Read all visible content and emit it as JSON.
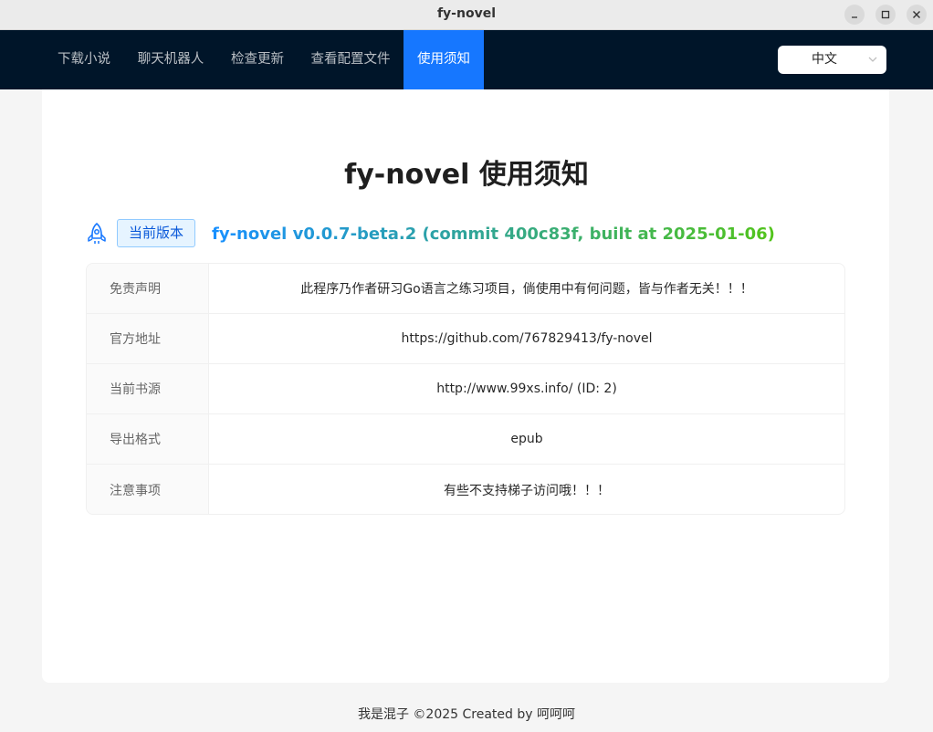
{
  "window": {
    "title": "fy-novel",
    "controls": [
      "minimize-icon",
      "maximize-icon",
      "close-icon"
    ]
  },
  "nav": {
    "items": [
      {
        "label": "下载小说",
        "active": false
      },
      {
        "label": "聊天机器人",
        "active": false
      },
      {
        "label": "检查更新",
        "active": false
      },
      {
        "label": "查看配置文件",
        "active": false
      },
      {
        "label": "使用须知",
        "active": true
      }
    ],
    "language": {
      "selected": "中文",
      "icon": "chevron-down-icon"
    }
  },
  "main": {
    "title": "fy-novel 使用须知",
    "version_icon": "rocket-icon",
    "version_tag": "当前版本",
    "version_text": "fy-novel v0.0.7-beta.2 (commit 400c83f, built at 2025-01-06)",
    "rows": [
      {
        "label": "免责声明",
        "value": "此程序乃作者研习Go语言之练习项目，倘使用中有何问题，皆与作者无关！！！"
      },
      {
        "label": "官方地址",
        "value": "https://github.com/767829413/fy-novel"
      },
      {
        "label": "当前书源",
        "value": "http://www.99xs.info/ (ID: 2)"
      },
      {
        "label": "导出格式",
        "value": "epub"
      },
      {
        "label": "注意事项",
        "value": "有些不支持梯子访问哦！！！"
      }
    ]
  },
  "footer": {
    "text": "我是混子 ©2025 Created by 呵呵呵"
  },
  "colors": {
    "nav_bg": "#001529",
    "nav_active": "#1677ff",
    "tag_border": "#91caff",
    "tag_bg": "#e6f4ff",
    "gradient_start": "#1890ff",
    "gradient_end": "#52c41a"
  }
}
